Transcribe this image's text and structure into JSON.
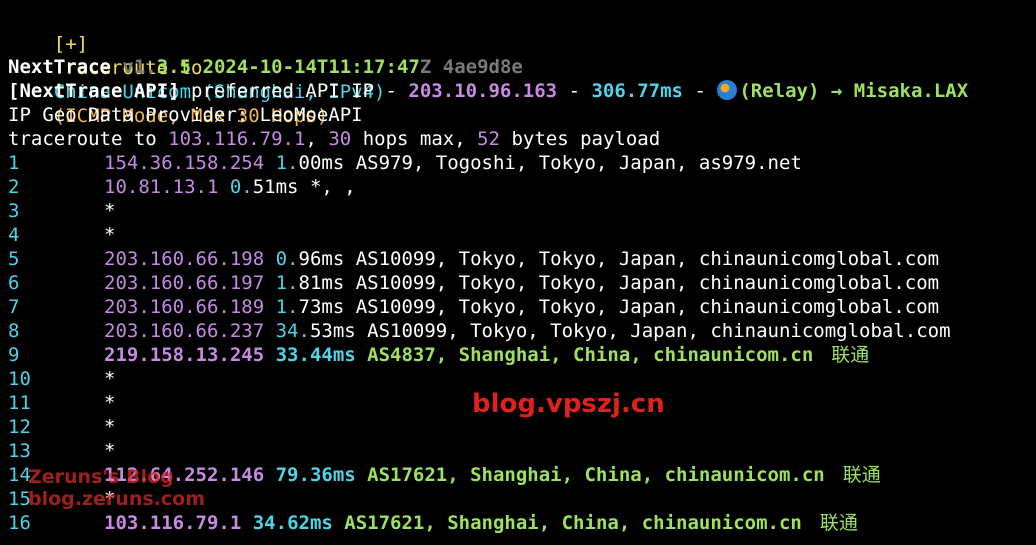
{
  "header": {
    "bracket": "[+]",
    "traceroute_to": "Traceroute to",
    "target": "China Unicom (Shanghai, IPv4)",
    "mode": "(ICMP Mode, Max 30 Hops)"
  },
  "nexttrace": {
    "name": "NextTrace",
    "ver_prefix": "v1.",
    "ver_rest": "3.5",
    "datetime": "2024-10-14T11:17:47",
    "z": "Z",
    "hash": "4ae9d8e"
  },
  "api": {
    "label": "[NextTrace API]",
    "text": "preferred API IP -",
    "ip": "203.10.96.163",
    "sep": "-",
    "latency": "306.77ms",
    "sep2": "-",
    "relay": "(Relay)",
    "arrow": "→",
    "node": "Misaka.LAX"
  },
  "geo_line": "IP Geo Data Provider: LeoMoeAPI",
  "trace_line": {
    "prefix": "traceroute to",
    "ip": "103.116.79.1",
    "hops": "30",
    "hops_text": "hops max,",
    "bytes": "52",
    "bytes_text": "bytes payload"
  },
  "hops": [
    {
      "n": "1",
      "ip": "154.36.158.254",
      "rtt_int": "1.",
      "rtt_rest": "00ms",
      "info": "AS979, Togoshi, Tokyo, Japan, as979.net",
      "style": "white"
    },
    {
      "n": "2",
      "ip": "10.81.13.1",
      "rtt_int": "0.",
      "rtt_rest": "51ms",
      "info": "*, ,",
      "style": "white"
    },
    {
      "n": "3",
      "star": "*"
    },
    {
      "n": "4",
      "star": "*"
    },
    {
      "n": "5",
      "ip": "203.160.66.198",
      "rtt_int": "0.",
      "rtt_rest": "96ms",
      "info": "AS10099, Tokyo, Tokyo, Japan, chinaunicomglobal.com",
      "style": "white"
    },
    {
      "n": "6",
      "ip": "203.160.66.197",
      "rtt_int": "1.",
      "rtt_rest": "81ms",
      "info": "AS10099, Tokyo, Tokyo, Japan, chinaunicomglobal.com",
      "style": "white"
    },
    {
      "n": "7",
      "ip": "203.160.66.189",
      "rtt_int": "1.",
      "rtt_rest": "73ms",
      "info": "AS10099, Tokyo, Tokyo, Japan, chinaunicomglobal.com",
      "style": "white"
    },
    {
      "n": "8",
      "ip": "203.160.66.237",
      "rtt_int": "34.",
      "rtt_rest": "53ms",
      "info": "AS10099, Tokyo, Tokyo, Japan, chinaunicomglobal.com",
      "style": "white"
    },
    {
      "n": "9",
      "ip": "219.158.13.245",
      "rtt_int": "33.",
      "rtt_rest": "44ms",
      "info": "AS4837, Shanghai, China, chinaunicom.cn",
      "cn": "联通",
      "style": "green"
    },
    {
      "n": "10",
      "star": "*"
    },
    {
      "n": "11",
      "star": "*"
    },
    {
      "n": "12",
      "star": "*"
    },
    {
      "n": "13",
      "star": "*"
    },
    {
      "n": "14",
      "ip": "112.64.252.146",
      "rtt_int": "79.",
      "rtt_rest": "36ms",
      "info": "AS17621, Shanghai, China, chinaunicom.cn",
      "cn": "联通",
      "style": "green"
    },
    {
      "n": "15",
      "star": "*"
    },
    {
      "n": "16",
      "ip": "103.116.79.1",
      "rtt_int": "34.",
      "rtt_rest": "62ms",
      "info": "AS17621, Shanghai, China, chinaunicom.cn",
      "cn": "联通",
      "style": "green"
    }
  ],
  "watermarks": {
    "vpszj": "blog.vpszj.cn",
    "zeruns1": "Zeruns's Blog",
    "zeruns2": "blog.zeruns.com"
  }
}
